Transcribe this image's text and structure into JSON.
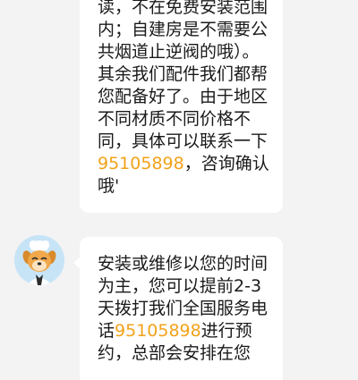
{
  "chat": {
    "messages": [
      {
        "lines": [
          {
            "text": "读，不在免费安装范围"
          },
          {
            "text": "内；自建房是不需要公"
          },
          {
            "text": "共烟道止逆阀的哦）。"
          },
          {
            "text": "其余我们配件我们都帮"
          },
          {
            "text": "您配备好了。由于地区"
          },
          {
            "text": "不同材质不同价格不"
          },
          {
            "text": "同，具体可以联系一下"
          },
          {
            "pre": "",
            "phone": "95105898",
            "post": "，咨询确认"
          },
          {
            "text": "哦'"
          }
        ]
      },
      {
        "lines": [
          {
            "text": "安装或维修以您的时间"
          },
          {
            "text": "为主，您可以提前2-3"
          },
          {
            "text": "天拨打我们全国服务电"
          },
          {
            "pre": "话",
            "phone": "95105898",
            "post": "进行预"
          },
          {
            "text": "约，总部会安排在您"
          }
        ]
      }
    ],
    "avatar": {
      "description": "dog-mascot-avatar",
      "bg_color": "#c7e4f7"
    }
  },
  "colors": {
    "background": "#f3f3f3",
    "bubble": "#ffffff",
    "text": "#1a1a1a",
    "phone_link": "#f2a21a"
  }
}
